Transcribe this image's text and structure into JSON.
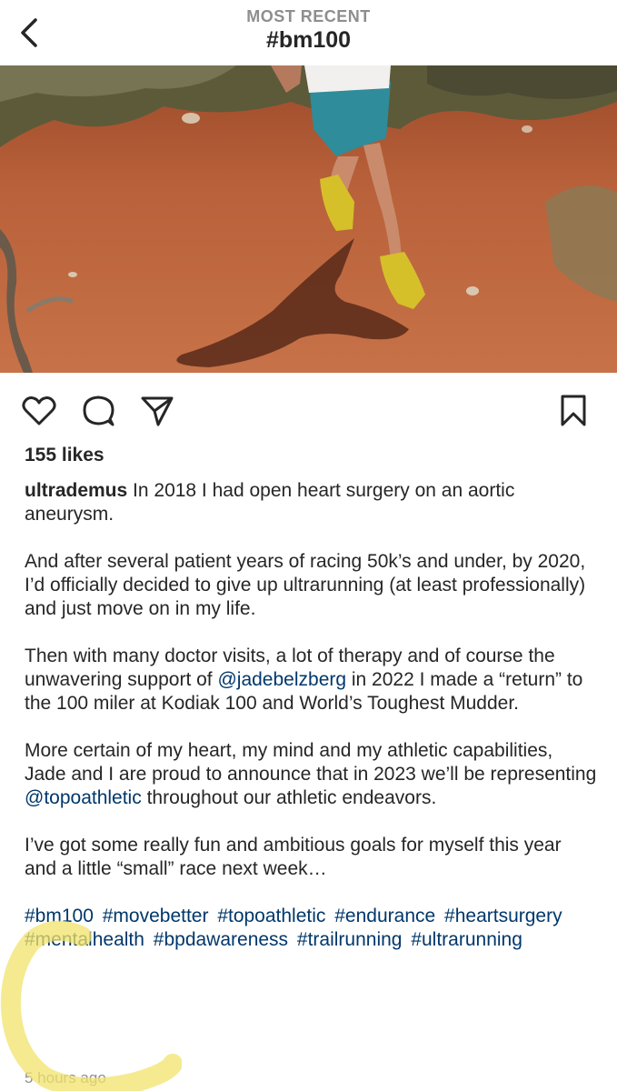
{
  "header": {
    "subtitle": "MOST RECENT",
    "title": "#bm100",
    "back_icon": "chevron-left-icon"
  },
  "post": {
    "image_alt": "Runner on red dirt trail",
    "actions": {
      "like_icon": "heart-icon",
      "comment_icon": "comment-icon",
      "share_icon": "send-icon",
      "save_icon": "bookmark-icon"
    },
    "likes": "155 likes",
    "username": "ultrademus",
    "caption": {
      "p1": " In 2018 I had open heart surgery on an aortic aneurysm.",
      "p2": "And after several patient years of racing 50k’s and under, by 2020, I’d officially decided to give up ultrarunning (at least professionally) and just move on in my life.",
      "p3_a": "Then with many doctor visits, a lot of therapy and of course the unwavering support of ",
      "p3_mention": "@jadebelzberg",
      "p3_b": " in 2022 I made a “return” to the 100 miler at Kodiak 100 and World’s Toughest Mudder.",
      "p4_a": "More certain of my heart, my mind and my athletic capabilities, Jade and I are proud to announce that in 2023 we’ll be representing  ",
      "p4_mention": "@topoathletic",
      "p4_b": " throughout our athletic endeavors.",
      "p5": "I’ve got some really fun and ambitious goals for myself this year and a little “small” race next week…",
      "hashtags": [
        "#bm100",
        "#movebetter",
        "#topoathletic",
        "#endurance",
        "#heartsurgery",
        "#mentalhealth",
        "#bpdawareness",
        "#trailrunning",
        "#ultrarunning"
      ]
    },
    "timestamp": "5 hours ago"
  },
  "colors": {
    "link": "#00376b",
    "muted": "#8e8e8e",
    "text": "#262626",
    "highlight": "#f2e36b"
  }
}
